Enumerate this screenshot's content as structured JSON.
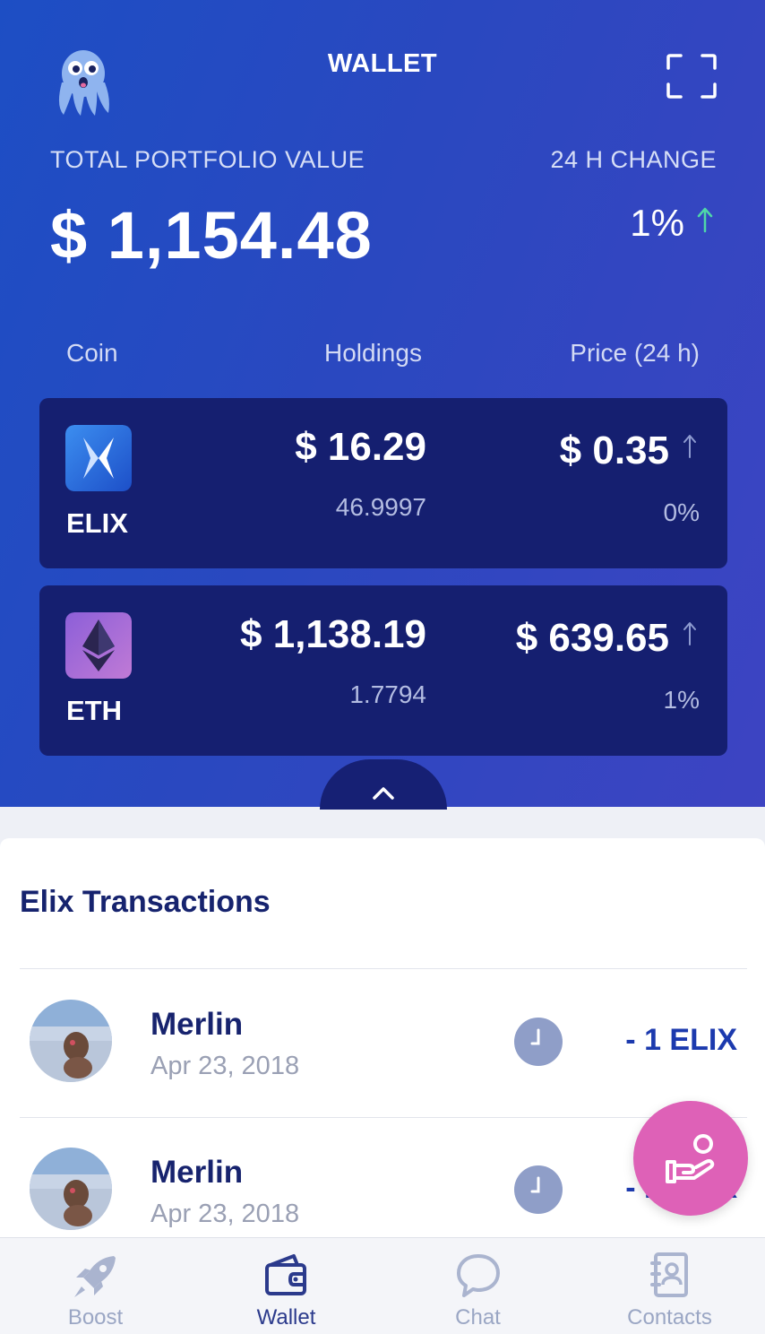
{
  "header": {
    "title": "WALLET",
    "logo_icon": "octopus-mascot-icon",
    "scan_icon": "scan-frame-icon"
  },
  "portfolio": {
    "total_label": "TOTAL PORTFOLIO VALUE",
    "total_value": "$ 1,154.48",
    "change_label": "24 H CHANGE",
    "change_value": "1%",
    "change_direction": "up"
  },
  "columns": {
    "coin": "Coin",
    "holdings": "Holdings",
    "price": "Price (24 h)"
  },
  "coins": [
    {
      "symbol": "ELIX",
      "holding_value": "$ 16.29",
      "quantity": "46.9997",
      "price": "$ 0.35",
      "change": "0%",
      "icon": "elix-coin-icon"
    },
    {
      "symbol": "ETH",
      "holding_value": "$ 1,138.19",
      "quantity": "1.7794",
      "price": "$ 639.65",
      "change": "1%",
      "icon": "ethereum-coin-icon"
    }
  ],
  "transactions": {
    "title": "Elix Transactions",
    "items": [
      {
        "name": "Merlin",
        "date": "Apr 23, 2018",
        "amount": "- 1 ELIX",
        "status_icon": "clock-icon"
      },
      {
        "name": "Merlin",
        "date": "Apr 23, 2018",
        "amount": "- 1 ELIX",
        "status_icon": "clock-icon"
      }
    ]
  },
  "fab": {
    "icon": "hand-coin-icon"
  },
  "nav": [
    {
      "label": "Boost",
      "icon": "rocket-icon"
    },
    {
      "label": "Wallet",
      "icon": "wallet-icon",
      "active": true
    },
    {
      "label": "Chat",
      "icon": "chat-bubble-icon"
    },
    {
      "label": "Contacts",
      "icon": "contacts-book-icon"
    }
  ],
  "colors": {
    "header_gradient_start": "#1d4ec4",
    "header_gradient_end": "#3d44c2",
    "card_bg": "#151f70",
    "up_arrow": "#4fd6a8",
    "fab": "#de61b7",
    "title_text": "#16236e"
  }
}
